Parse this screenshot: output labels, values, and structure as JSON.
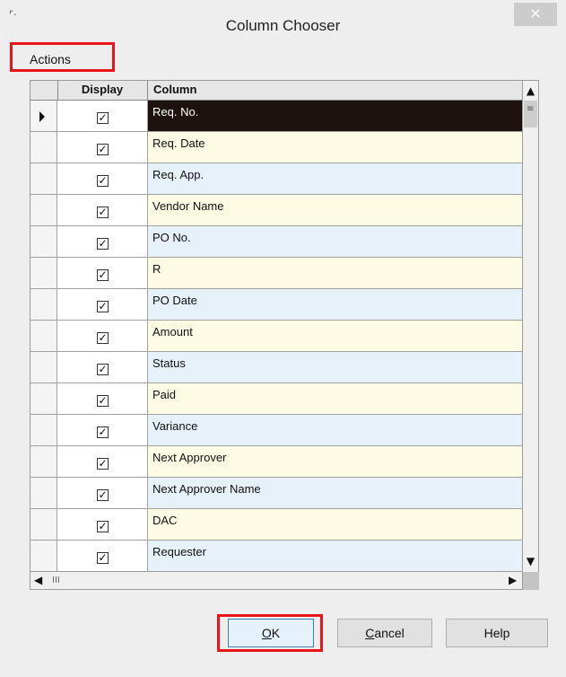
{
  "window": {
    "title": "Column Chooser",
    "app_icon": "dialog-icon",
    "close_glyph": "×"
  },
  "menu": {
    "actions_label": "Actions"
  },
  "grid": {
    "headers": {
      "display": "Display",
      "column": "Column"
    },
    "rows": [
      {
        "column": "Req. No.",
        "display": true,
        "selected": true
      },
      {
        "column": "Req. Date",
        "display": true
      },
      {
        "column": "Req. App.",
        "display": true
      },
      {
        "column": "Vendor Name",
        "display": true
      },
      {
        "column": "PO No.",
        "display": true
      },
      {
        "column": "R",
        "display": true
      },
      {
        "column": "PO Date",
        "display": true
      },
      {
        "column": "Amount",
        "display": true
      },
      {
        "column": "Status",
        "display": true
      },
      {
        "column": "Paid",
        "display": true
      },
      {
        "column": "Variance",
        "display": true
      },
      {
        "column": "Next Approver",
        "display": true
      },
      {
        "column": "Next Approver Name",
        "display": true
      },
      {
        "column": "DAC",
        "display": true
      },
      {
        "column": "Requester",
        "display": true
      }
    ]
  },
  "scrollbars": {
    "horizontal_thumb_grip": "III"
  },
  "buttons": {
    "ok_mnemonic": "O",
    "ok_rest": "K",
    "cancel_mnemonic": "C",
    "cancel_rest": "ancel",
    "help_label": "Help"
  },
  "colors": {
    "highlight_border": "#e8141a",
    "selected_row": "#1d120f",
    "row_even": "#fdfbe3",
    "row_odd": "#e6f1fa"
  }
}
